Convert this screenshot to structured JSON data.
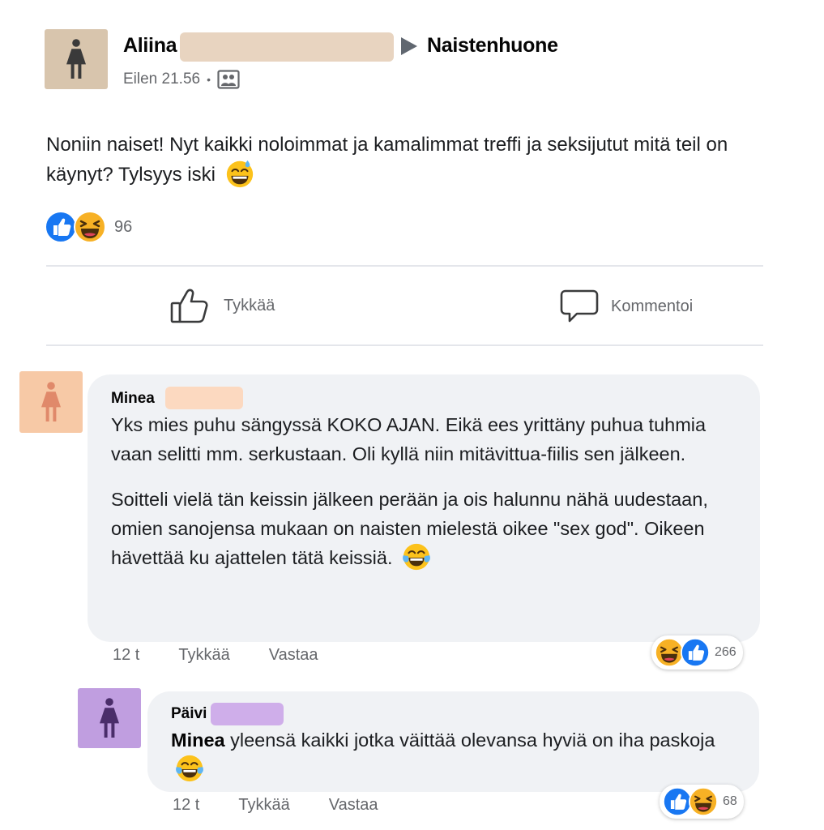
{
  "post": {
    "author": "Aliina",
    "arrow": "▶",
    "group": "Naistenhuone",
    "time": "Eilen 21.56",
    "separator": "•",
    "audience_icon": "group-audience-icon",
    "text": "Noniin naiset! Nyt kaikki noloimmat ja kamalimmat treffi ja seksijutut mitä teil on käynyt? Tylsyys iski",
    "text_emoji": "grinning-sweat-emoji",
    "reaction_icons": [
      "like-reaction-icon",
      "haha-reaction-icon"
    ],
    "reaction_count": "96",
    "avatar_color": "#d8c5ad",
    "redaction_color": "#e8d4c0"
  },
  "actions": {
    "like_label": "Tykkää",
    "comment_label": "Kommentoi"
  },
  "comments": [
    {
      "author": "Minea",
      "paragraph1": "Yks mies puhu sängyssä KOKO AJAN. Eikä ees yrittäny puhua tuhmia vaan selitti mm. serkustaan. Oli kyllä niin mitävittua-fiilis sen jälkeen.",
      "paragraph2": "Soitteli vielä tän keissin jälkeen perään ja ois halunnu nähä uudestaan, omien sanojensa mukaan on naisten mielestä oikee \"sex god\". Oikeen hävettää ku ajattelen tätä keissiä.",
      "emoji": "tears-of-joy-emoji",
      "time": "12 t",
      "like_label": "Tykkää",
      "reply_label": "Vastaa",
      "reaction_icons": [
        "haha-reaction-icon",
        "like-reaction-icon"
      ],
      "reaction_count": "266",
      "avatar_color": "#f7c9a6",
      "redaction_color": "#fcd9c0"
    },
    {
      "author": "Päivi",
      "mention": "Minea",
      "text": "yleensä kaikki jotka väittää olevansa hyviä on iha paskoja",
      "emoji": "tears-of-joy-emoji",
      "time": "12 t",
      "like_label": "Tykkää",
      "reply_label": "Vastaa",
      "reaction_icons": [
        "like-reaction-icon",
        "haha-reaction-icon"
      ],
      "reaction_count": "68",
      "avatar_color": "#c09ee0",
      "redaction_color": "#cfaeea"
    }
  ],
  "colors": {
    "like_blue": "#1877f2",
    "haha_yellow": "#f7b125",
    "muted_text": "#65676b",
    "bubble_bg": "#f0f2f5"
  }
}
